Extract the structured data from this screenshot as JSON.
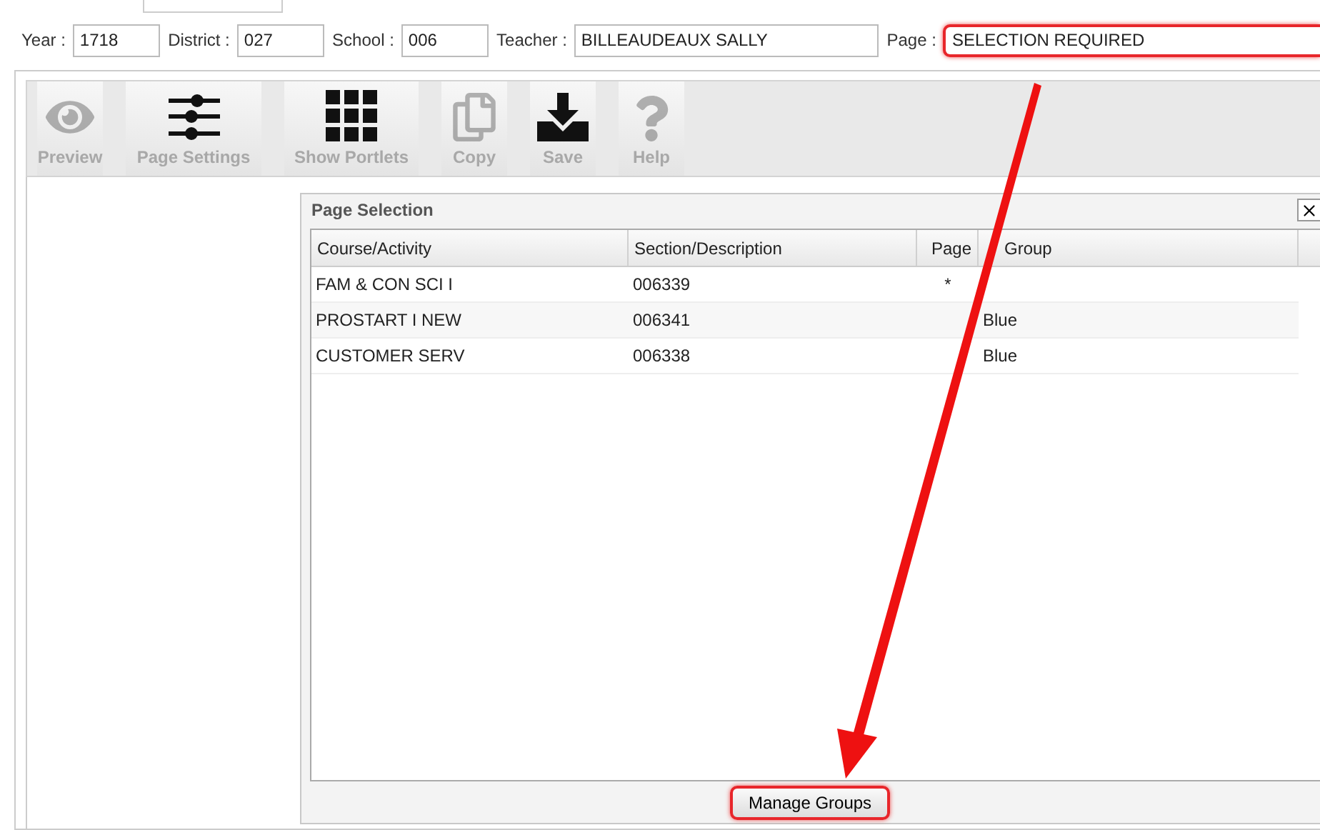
{
  "filters": [
    {
      "label": "Year :",
      "value": "1718",
      "highlighted": false
    },
    {
      "label": "District :",
      "value": "027",
      "highlighted": false
    },
    {
      "label": "School :",
      "value": "006",
      "highlighted": false
    },
    {
      "label": "Teacher :",
      "value": "BILLEAUDEAUX SALLY",
      "highlighted": false
    },
    {
      "label": "Page :",
      "value": "SELECTION REQUIRED",
      "highlighted": true
    }
  ],
  "toolbar": [
    {
      "kind": "eye",
      "label": "Preview",
      "disabled": true
    },
    {
      "kind": "sliders",
      "label": "Page Settings",
      "disabled": true
    },
    {
      "kind": "grid",
      "label": "Show Portlets",
      "disabled": true
    },
    {
      "kind": "copy",
      "label": "Copy",
      "disabled": true
    },
    {
      "kind": "save",
      "label": "Save",
      "disabled": true
    },
    {
      "kind": "help",
      "label": "Help",
      "disabled": true
    }
  ],
  "dialog": {
    "title": "Page Selection",
    "columns": [
      "Course/Activity",
      "Section/Description",
      "Page",
      "Group"
    ],
    "rows": [
      {
        "cells": [
          "FAM & CON SCI I",
          "006339",
          "*",
          ""
        ]
      },
      {
        "cells": [
          "PROSTART I NEW",
          "006341",
          "",
          "Blue"
        ]
      },
      {
        "cells": [
          "CUSTOMER SERV",
          "006338",
          "",
          "Blue"
        ]
      }
    ],
    "button": {
      "label": "Manage Groups",
      "highlighted": true
    }
  },
  "annotation": {
    "kind": "arrow"
  }
}
